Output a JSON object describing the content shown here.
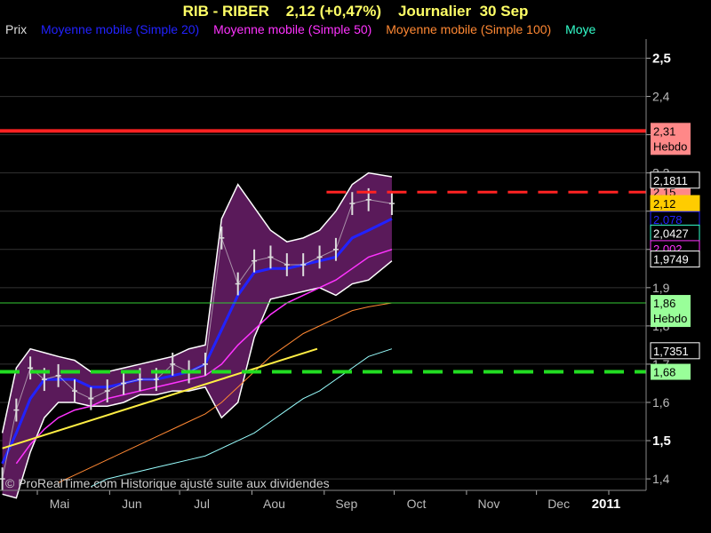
{
  "header": {
    "ticker": "RIB - RIBER",
    "quote": "2,12 (+0,47%)",
    "period": "Journalier",
    "date": "30 Sep"
  },
  "legend": [
    {
      "label": "Prix",
      "color": "#dddddd"
    },
    {
      "label": "Moyenne mobile (Simple 20)",
      "color": "#2222ff"
    },
    {
      "label": "Moyenne mobile (Simple 50)",
      "color": "#ff33ff"
    },
    {
      "label": "Moyenne mobile (Simple 100)",
      "color": "#ff8833"
    },
    {
      "label": "Moye",
      "color": "#33ffcc"
    }
  ],
  "watermark": "© ProRealTime.com Historique ajusté suite aux dividendes",
  "colors": {
    "background": "#000000",
    "grid": "#333333",
    "band_fill": "#5a1a5a",
    "band_edge": "#ffffff",
    "price": "#dddddd",
    "ma20": "#2222ff",
    "ma50": "#ff33ff",
    "ma100": "#ff8833",
    "ma200": "#99ffff",
    "resistance": "#ff2222",
    "support_green": "#22dd22",
    "thin_green": "#33cc33",
    "trend": "#ffee44"
  },
  "chart_data": {
    "type": "line",
    "title": "RIB - RIBER 2,12 (+0,47%) Journalier 30 Sep",
    "x_tick_labels": [
      "Mai",
      "Jun",
      "Jul",
      "Aou",
      "Sep",
      "Oct",
      "Nov",
      "Dec",
      "2011"
    ],
    "y_tick_labels": [
      "2,5",
      "2,4",
      "2,3",
      "2,2",
      "2,1",
      "2,0",
      "1,9",
      "1,8",
      "1,7",
      "1,6",
      "1,5",
      "1,4"
    ],
    "y_bold": [
      "2,5",
      "1,5"
    ],
    "ylim": [
      1.37,
      2.55
    ],
    "x_domain": [
      "2010-04-15",
      "2011-01-17"
    ],
    "grid": true,
    "x": [
      "2010-04-16",
      "2010-04-22",
      "2010-04-28",
      "2010-05-04",
      "2010-05-10",
      "2010-05-17",
      "2010-05-24",
      "2010-05-31",
      "2010-06-07",
      "2010-06-14",
      "2010-06-21",
      "2010-06-28",
      "2010-07-05",
      "2010-07-12",
      "2010-07-19",
      "2010-07-26",
      "2010-08-02",
      "2010-08-09",
      "2010-08-16",
      "2010-08-23",
      "2010-08-30",
      "2010-09-06",
      "2010-09-13",
      "2010-09-20",
      "2010-09-30"
    ],
    "series": [
      {
        "name": "Prix",
        "values": [
          1.4,
          1.58,
          1.69,
          1.66,
          1.67,
          1.63,
          1.61,
          1.63,
          1.65,
          1.66,
          1.66,
          1.7,
          1.68,
          1.7,
          2.03,
          1.91,
          1.97,
          1.98,
          1.96,
          1.96,
          1.98,
          2.0,
          2.12,
          2.13,
          2.12
        ]
      },
      {
        "name": "Moyenne mobile (Simple 20)",
        "values": [
          1.44,
          1.52,
          1.61,
          1.66,
          1.66,
          1.66,
          1.64,
          1.64,
          1.65,
          1.66,
          1.66,
          1.67,
          1.68,
          1.7,
          1.79,
          1.88,
          1.94,
          1.95,
          1.95,
          1.96,
          1.97,
          1.98,
          2.03,
          2.05,
          2.08
        ]
      },
      {
        "name": "Moyenne mobile (Simple 50)",
        "values": [
          null,
          1.44,
          1.49,
          1.53,
          1.56,
          1.58,
          1.59,
          1.61,
          1.62,
          1.63,
          1.64,
          1.65,
          1.66,
          1.67,
          1.7,
          1.75,
          1.79,
          1.83,
          1.86,
          1.88,
          1.9,
          1.92,
          1.95,
          1.98,
          2.0
        ]
      },
      {
        "name": "Moyenne mobile (Simple 100)",
        "values": [
          null,
          null,
          null,
          null,
          1.39,
          1.41,
          1.43,
          1.45,
          1.47,
          1.49,
          1.51,
          1.53,
          1.55,
          1.57,
          1.6,
          1.64,
          1.68,
          1.72,
          1.75,
          1.78,
          1.8,
          1.82,
          1.84,
          1.85,
          1.86
        ]
      },
      {
        "name": "Moye",
        "values": [
          null,
          null,
          null,
          null,
          null,
          null,
          1.38,
          1.4,
          1.41,
          1.42,
          1.43,
          1.44,
          1.45,
          1.46,
          1.48,
          1.5,
          1.52,
          1.55,
          1.58,
          1.61,
          1.63,
          1.66,
          1.69,
          1.72,
          1.74
        ]
      }
    ],
    "bollinger_upper": [
      1.52,
      1.69,
      1.74,
      1.73,
      1.72,
      1.71,
      1.68,
      1.68,
      1.69,
      1.7,
      1.71,
      1.72,
      1.74,
      1.75,
      2.08,
      2.17,
      2.11,
      2.05,
      2.02,
      2.03,
      2.05,
      2.1,
      2.17,
      2.2,
      2.19
    ],
    "bollinger_lower": [
      1.36,
      1.35,
      1.47,
      1.56,
      1.6,
      1.6,
      1.59,
      1.59,
      1.6,
      1.62,
      1.62,
      1.63,
      1.63,
      1.64,
      1.56,
      1.6,
      1.77,
      1.87,
      1.88,
      1.89,
      1.9,
      1.88,
      1.91,
      1.92,
      1.97
    ],
    "horizontal_levels": [
      {
        "value": 2.31,
        "label": "2,31",
        "sublabel": "Hebdo",
        "style": "solid-red",
        "label_bg": "#ff8888"
      },
      {
        "value": 2.15,
        "label": "2,15",
        "style": "dashed-red",
        "from": "2010-09-02",
        "label_bg": "#ff8888"
      },
      {
        "value": 1.86,
        "label": "1,86",
        "sublabel": "Hebdo",
        "style": "thin-green",
        "label_bg": "#99ff99"
      },
      {
        "value": 1.68,
        "label": "1,68",
        "style": "dashed-green",
        "label_bg": "#99ff99"
      }
    ],
    "value_labels": [
      {
        "text": "2,1811",
        "value": 2.1811,
        "bg": "#000000",
        "border": "#ffffff",
        "fg": "#ffffff"
      },
      {
        "text": "2,12",
        "value": 2.12,
        "bg": "#ffcc00",
        "border": "#ffcc00",
        "fg": "#000000"
      },
      {
        "text": "2,078",
        "value": 2.078,
        "bg": "#000000",
        "border": "#2222ff",
        "fg": "#2222ff"
      },
      {
        "text": "2,0427",
        "value": 2.0427,
        "bg": "#000000",
        "border": "#33ffcc",
        "fg": "#ffffff"
      },
      {
        "text": "2,002",
        "value": 2.002,
        "bg": "#000000",
        "border": "#ff33ff",
        "fg": "#ff33ff"
      },
      {
        "text": "1,9749",
        "value": 1.9749,
        "bg": "#000000",
        "border": "#ffffff",
        "fg": "#ffffff"
      },
      {
        "text": "1,7351",
        "value": 1.7351,
        "bg": "#000000",
        "border": "#ffffff",
        "fg": "#ffffff"
      }
    ],
    "trendline": {
      "from": [
        "2010-04-16",
        1.48
      ],
      "to": [
        "2010-08-29",
        1.74
      ]
    }
  }
}
